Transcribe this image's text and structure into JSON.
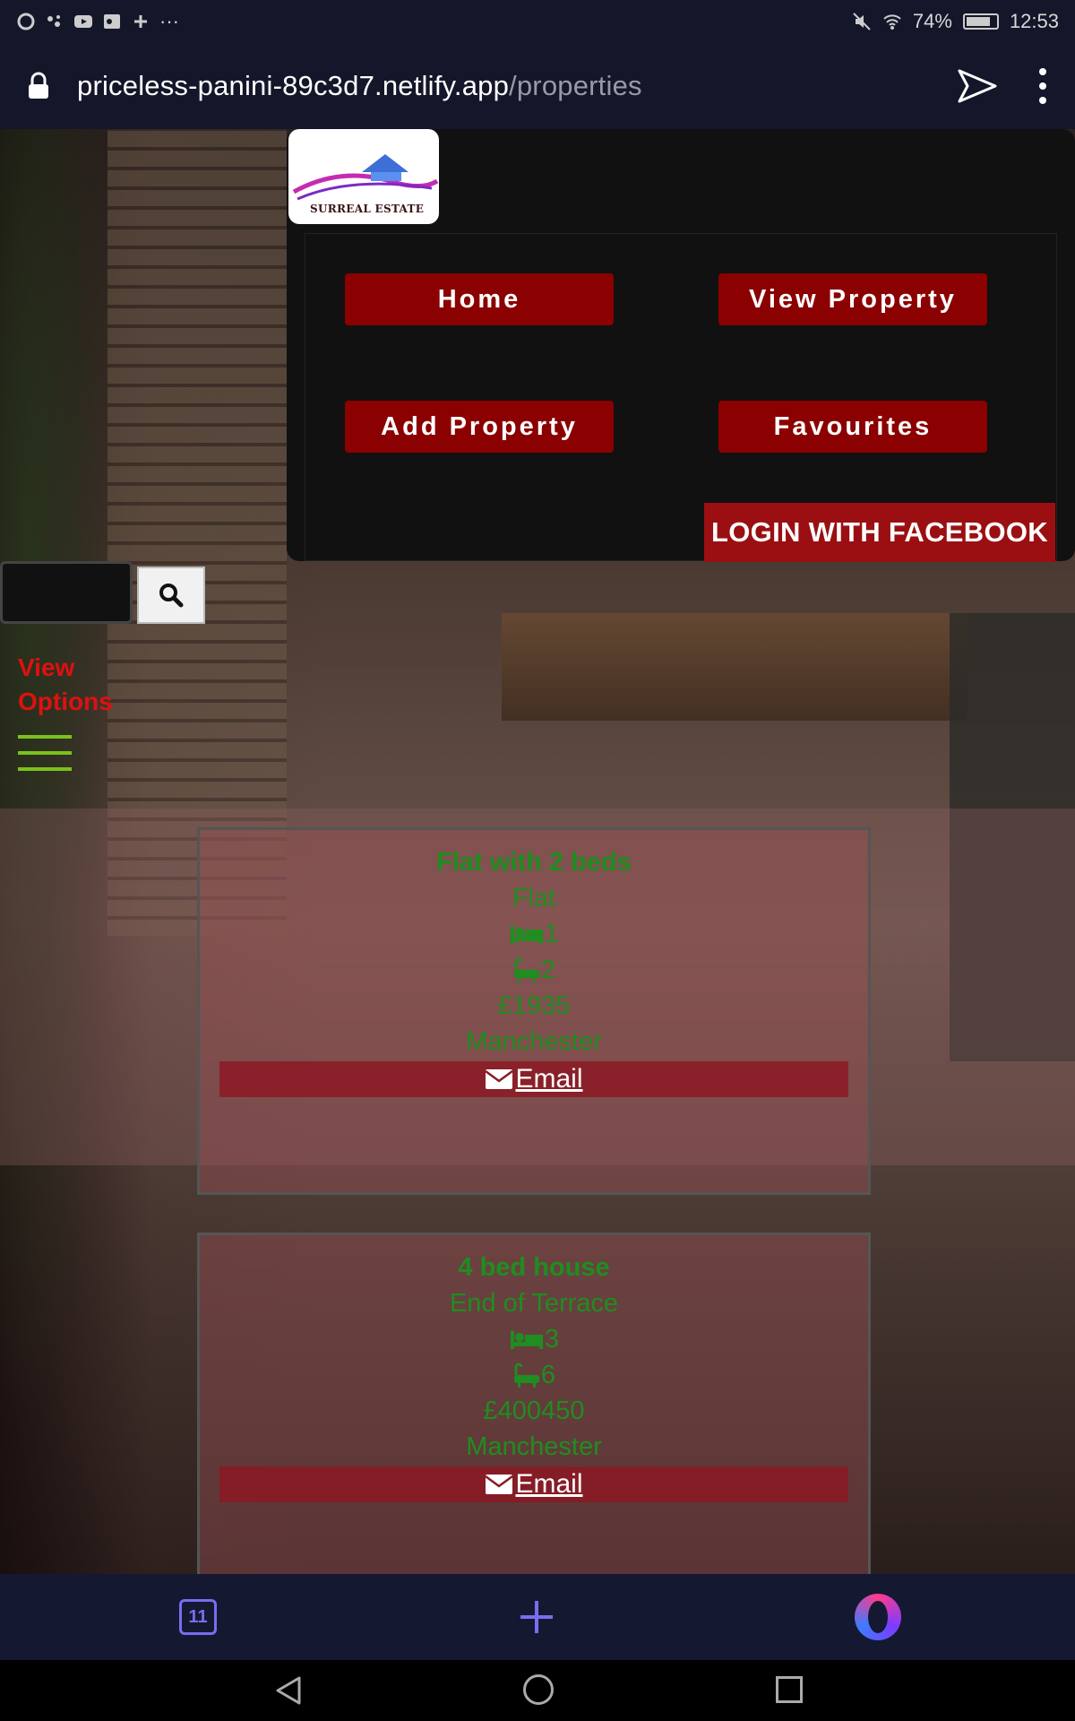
{
  "status_bar": {
    "battery": "74%",
    "time": "12:53",
    "dots": "···"
  },
  "address_bar": {
    "url_host": "priceless-panini-89c3d7.netlify.app",
    "url_path": "/properties"
  },
  "nav": {
    "logo_text": "SURREAL ESTATE",
    "home": "Home",
    "view_property": "View Property",
    "add_property": "Add Property",
    "favourites": "Favourites",
    "login_facebook": "LOGIN WITH FACEBOOK"
  },
  "sidebar": {
    "view_options": "View Options"
  },
  "properties": [
    {
      "title": "Flat with 2 beds",
      "type": "Flat",
      "bedrooms": "1",
      "bathrooms": "2",
      "price": "£1935",
      "city": "Manchester",
      "email_label": "Email"
    },
    {
      "title": "4 bed house",
      "type": "End of Terrace",
      "bedrooms": "3",
      "bathrooms": "6",
      "price": "£400450",
      "city": "Manchester",
      "email_label": "Email"
    }
  ],
  "browser_bottom": {
    "tab_count": "11"
  },
  "colors": {
    "nav_button": "#8b0000",
    "card_text": "#1f8d1f",
    "view_options": "#e01010"
  }
}
